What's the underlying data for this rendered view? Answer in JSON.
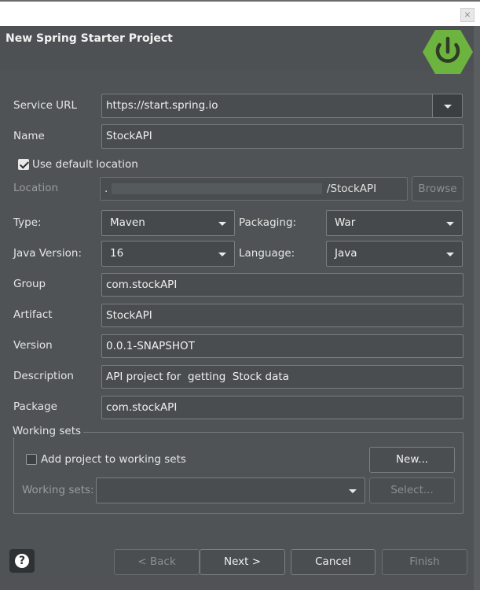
{
  "window": {
    "title": "New Spring Starter Project",
    "close_glyph": "×"
  },
  "icons": {
    "logo": "spring-power-logo-icon",
    "help": "help-icon",
    "dropdown": "chevron-down-icon"
  },
  "colors": {
    "logo": "#6db33f",
    "background": "#4f5355"
  },
  "form": {
    "service_url": {
      "label": "Service URL",
      "value": "https://start.spring.io"
    },
    "name": {
      "label": "Name",
      "value": "StockAPI"
    },
    "use_default_location": {
      "label": "Use default location",
      "checked": true
    },
    "location": {
      "label": "Location",
      "value_prefix": ".",
      "value_suffix": "/StockAPI",
      "browse_label": "Browse"
    },
    "type": {
      "label": "Type:",
      "value": "Maven"
    },
    "packaging": {
      "label": "Packaging:",
      "value": "War"
    },
    "java_version": {
      "label": "Java Version:",
      "value": "16"
    },
    "language": {
      "label": "Language:",
      "value": "Java"
    },
    "group": {
      "label": "Group",
      "value": "com.stockAPI"
    },
    "artifact": {
      "label": "Artifact",
      "value": "StockAPI"
    },
    "version": {
      "label": "Version",
      "value": "0.0.1-SNAPSHOT"
    },
    "description": {
      "label": "Description",
      "value": "API project for  getting  Stock data"
    },
    "package": {
      "label": "Package",
      "value": "com.stockAPI"
    }
  },
  "working_sets": {
    "group_label": "Working sets",
    "add_checkbox_label": "Add project to working sets",
    "add_checked": false,
    "new_button": "New...",
    "field_label": "Working sets:",
    "field_value": "",
    "select_button": "Select..."
  },
  "footer": {
    "help_glyph": "?",
    "back": "< Back",
    "next": "Next >",
    "cancel": "Cancel",
    "finish": "Finish"
  }
}
